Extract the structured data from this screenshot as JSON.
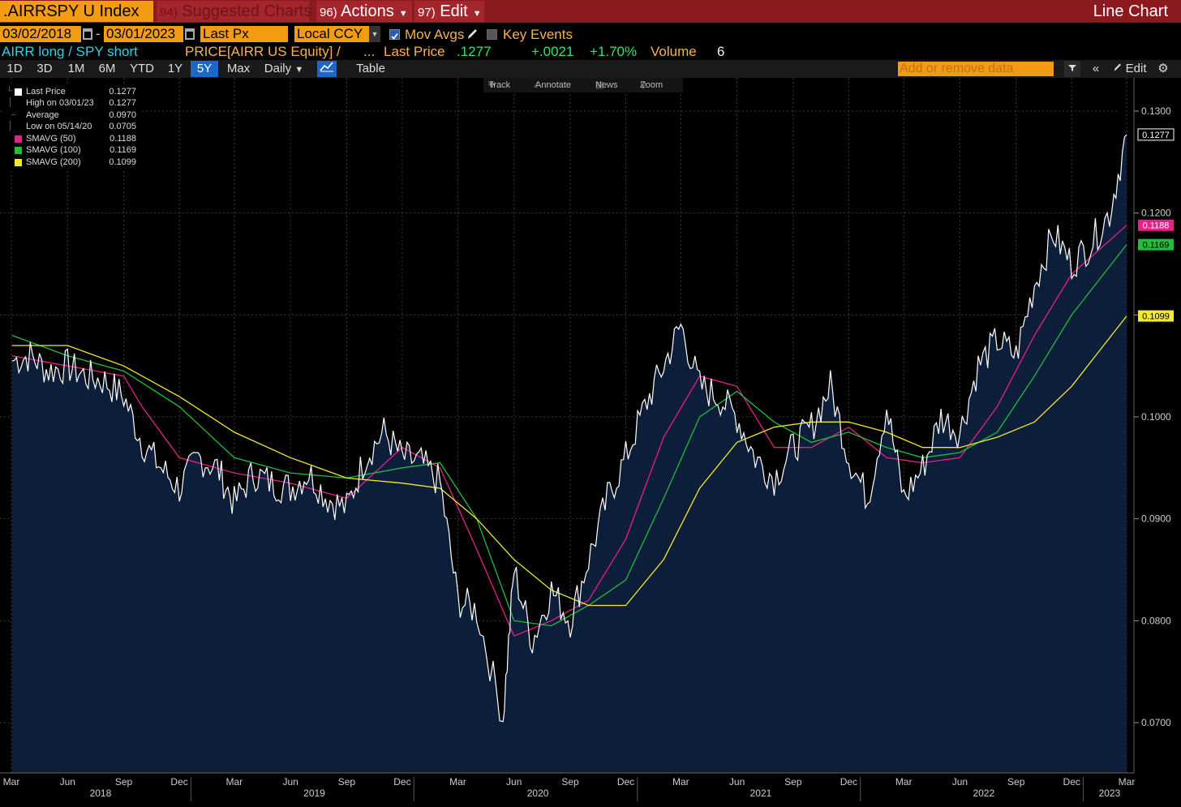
{
  "header": {
    "ticker": ".AIRRSPY U Index",
    "suggested_num": "94)",
    "suggested_label": "Suggested Charts",
    "actions_num": "96)",
    "actions_label": "Actions",
    "edit_num": "97)",
    "edit_label": "Edit",
    "chart_type": "Line Chart"
  },
  "controls": {
    "start_date": "03/02/2018",
    "date_sep": "-",
    "end_date": "03/01/2023",
    "field": "Last Px",
    "currency": "Local CCY",
    "mov_avgs_label": "Mov Avgs",
    "mov_avgs_checked": true,
    "key_events_label": "Key Events",
    "key_events_checked": false
  },
  "info": {
    "description": "AIRR long / SPY short",
    "formula": "PRICE[AIRR US Equity] /",
    "ellipsis": "...",
    "last_price_label": "Last Price",
    "last_price": ".1277",
    "change": "+.0021",
    "change_pct": "+1.70%",
    "volume_label": "Volume",
    "volume": "6"
  },
  "toolbar": {
    "ranges": [
      "1D",
      "3D",
      "1M",
      "6M",
      "YTD",
      "1Y",
      "5Y",
      "Max"
    ],
    "active_range": "5Y",
    "frequency": "Daily",
    "table_label": "Table",
    "add_data_placeholder": "Add or remove data",
    "edit_label": "Edit"
  },
  "chart_tools": {
    "track": "Track",
    "annotate": "Annotate",
    "news": "News",
    "zoom": "Zoom"
  },
  "legend": [
    {
      "label": "Last Price",
      "value": "0.1277",
      "color": "#ffffff"
    },
    {
      "label": "High on 03/01/23",
      "value": "0.1277",
      "color": ""
    },
    {
      "label": "Average",
      "value": "0.0970",
      "color": ""
    },
    {
      "label": "Low on 05/14/20",
      "value": "0.0705",
      "color": ""
    },
    {
      "label": "SMAVG (50)",
      "value": "0.1188",
      "color": "#e8208a"
    },
    {
      "label": "SMAVG (100)",
      "value": "0.1169",
      "color": "#1fbf3a"
    },
    {
      "label": "SMAVG (200)",
      "value": "0.1099",
      "color": "#f2ea2a"
    }
  ],
  "colors": {
    "accent_orange": "#f39c12",
    "title_bar": "#8b1a1f",
    "area_fill": "#0d1e3a",
    "price_line": "#ffffff",
    "sma50": "#e8208a",
    "sma100": "#1fbf3a",
    "sma200": "#f2ea2a"
  },
  "chart_data": {
    "type": "line",
    "ylim": [
      0.065,
      0.135
    ],
    "yticks": [
      "0.1300",
      "0.1200",
      "0.1100",
      "0.1000",
      "0.0900",
      "0.0800",
      "0.0700"
    ],
    "ytick_values": [
      0.13,
      0.12,
      0.11,
      0.1,
      0.09,
      0.08,
      0.07
    ],
    "x_months": [
      "Mar",
      "Jun",
      "Sep",
      "Dec",
      "Mar",
      "Jun",
      "Sep",
      "Dec",
      "Mar",
      "Jun",
      "Sep",
      "Dec",
      "Mar",
      "Jun",
      "Sep",
      "Dec",
      "Mar",
      "Jun",
      "Sep",
      "Dec",
      "Mar"
    ],
    "x_years": [
      "2018",
      "2019",
      "2020",
      "2021",
      "2022",
      "2023"
    ],
    "last_value_labels": [
      {
        "value": 0.1277,
        "text": "0.1277",
        "color": "#ffffff"
      },
      {
        "value": 0.1188,
        "text": "0.1188",
        "color": "#e8208a"
      },
      {
        "value": 0.1169,
        "text": "0.1169",
        "color": "#1fbf3a"
      },
      {
        "value": 0.1099,
        "text": "0.1099",
        "color": "#f2ea2a"
      }
    ],
    "series": [
      {
        "name": "Last Price",
        "x": [
          "2018-03-02",
          "2018-04-01",
          "2018-05-01",
          "2018-06-01",
          "2018-07-01",
          "2018-08-01",
          "2018-09-01",
          "2018-10-01",
          "2018-11-01",
          "2018-12-01",
          "2019-01-01",
          "2019-02-01",
          "2019-03-01",
          "2019-04-01",
          "2019-05-01",
          "2019-06-01",
          "2019-07-01",
          "2019-08-01",
          "2019-09-01",
          "2019-10-01",
          "2019-11-01",
          "2019-12-01",
          "2020-01-01",
          "2020-02-01",
          "2020-03-01",
          "2020-04-01",
          "2020-05-14",
          "2020-06-01",
          "2020-07-01",
          "2020-08-01",
          "2020-09-01",
          "2020-10-01",
          "2020-11-01",
          "2020-12-01",
          "2021-01-01",
          "2021-02-01",
          "2021-03-01",
          "2021-04-01",
          "2021-05-01",
          "2021-06-01",
          "2021-07-01",
          "2021-08-01",
          "2021-09-01",
          "2021-10-01",
          "2021-11-01",
          "2021-12-01",
          "2022-01-01",
          "2022-02-01",
          "2022-03-01",
          "2022-04-01",
          "2022-05-01",
          "2022-06-01",
          "2022-07-01",
          "2022-08-01",
          "2022-09-01",
          "2022-10-01",
          "2022-11-01",
          "2022-12-01",
          "2023-01-01",
          "2023-02-01",
          "2023-03-01"
        ],
        "values": [
          0.1055,
          0.106,
          0.1045,
          0.105,
          0.104,
          0.1035,
          0.102,
          0.0975,
          0.095,
          0.093,
          0.096,
          0.095,
          0.0915,
          0.0945,
          0.0935,
          0.093,
          0.0945,
          0.092,
          0.091,
          0.096,
          0.0985,
          0.096,
          0.0955,
          0.0935,
          0.082,
          0.081,
          0.0705,
          0.085,
          0.078,
          0.083,
          0.08,
          0.086,
          0.092,
          0.096,
          0.101,
          0.105,
          0.109,
          0.103,
          0.102,
          0.1,
          0.096,
          0.094,
          0.097,
          0.099,
          0.103,
          0.096,
          0.092,
          0.101,
          0.092,
          0.095,
          0.1,
          0.0985,
          0.105,
          0.1075,
          0.106,
          0.113,
          0.118,
          0.115,
          0.117,
          0.12,
          0.1277
        ]
      },
      {
        "name": "SMAVG (50)",
        "x": [
          "2018-03-02",
          "2018-06-01",
          "2018-09-01",
          "2018-10-01",
          "2018-12-01",
          "2019-03-01",
          "2019-06-01",
          "2019-09-01",
          "2019-12-01",
          "2020-01-01",
          "2020-02-01",
          "2020-04-01",
          "2020-06-01",
          "2020-08-01",
          "2020-10-01",
          "2020-12-01",
          "2021-02-01",
          "2021-04-01",
          "2021-06-01",
          "2021-08-01",
          "2021-10-01",
          "2021-12-01",
          "2022-02-01",
          "2022-04-01",
          "2022-06-01",
          "2022-08-01",
          "2022-10-01",
          "2022-12-01",
          "2023-03-01"
        ],
        "values": [
          0.106,
          0.105,
          0.104,
          0.101,
          0.096,
          0.0945,
          0.0935,
          0.092,
          0.097,
          0.096,
          0.095,
          0.087,
          0.0785,
          0.08,
          0.082,
          0.088,
          0.098,
          0.104,
          0.103,
          0.097,
          0.097,
          0.099,
          0.096,
          0.0955,
          0.096,
          0.101,
          0.108,
          0.114,
          0.1188
        ]
      },
      {
        "name": "SMAVG (100)",
        "x": [
          "2018-03-02",
          "2018-06-01",
          "2018-09-01",
          "2018-12-01",
          "2019-03-01",
          "2019-06-01",
          "2019-09-01",
          "2019-12-01",
          "2020-02-01",
          "2020-04-01",
          "2020-06-01",
          "2020-08-01",
          "2020-10-01",
          "2020-12-01",
          "2021-02-01",
          "2021-04-01",
          "2021-06-01",
          "2021-08-01",
          "2021-10-01",
          "2021-12-01",
          "2022-02-01",
          "2022-04-01",
          "2022-06-01",
          "2022-08-01",
          "2022-10-01",
          "2022-12-01",
          "2023-03-01"
        ],
        "values": [
          0.108,
          0.106,
          0.1045,
          0.101,
          0.096,
          0.0945,
          0.094,
          0.095,
          0.0955,
          0.09,
          0.08,
          0.0795,
          0.0815,
          0.084,
          0.092,
          0.1,
          0.1025,
          0.0995,
          0.0975,
          0.0985,
          0.097,
          0.096,
          0.0965,
          0.0985,
          0.104,
          0.11,
          0.1169
        ]
      },
      {
        "name": "SMAVG (200)",
        "x": [
          "2018-03-02",
          "2018-06-01",
          "2018-09-01",
          "2018-12-01",
          "2019-03-01",
          "2019-06-01",
          "2019-09-01",
          "2019-12-01",
          "2020-02-01",
          "2020-04-01",
          "2020-06-01",
          "2020-08-01",
          "2020-10-01",
          "2020-12-01",
          "2021-02-01",
          "2021-04-01",
          "2021-06-01",
          "2021-08-01",
          "2021-10-01",
          "2021-12-01",
          "2022-02-01",
          "2022-04-01",
          "2022-06-01",
          "2022-08-01",
          "2022-10-01",
          "2022-12-01",
          "2023-03-01"
        ],
        "values": [
          0.107,
          0.107,
          0.105,
          0.102,
          0.0985,
          0.096,
          0.094,
          0.0935,
          0.093,
          0.09,
          0.086,
          0.083,
          0.0815,
          0.0815,
          0.086,
          0.093,
          0.0975,
          0.099,
          0.0995,
          0.0995,
          0.0985,
          0.097,
          0.097,
          0.098,
          0.0995,
          0.103,
          0.1099
        ]
      }
    ]
  }
}
